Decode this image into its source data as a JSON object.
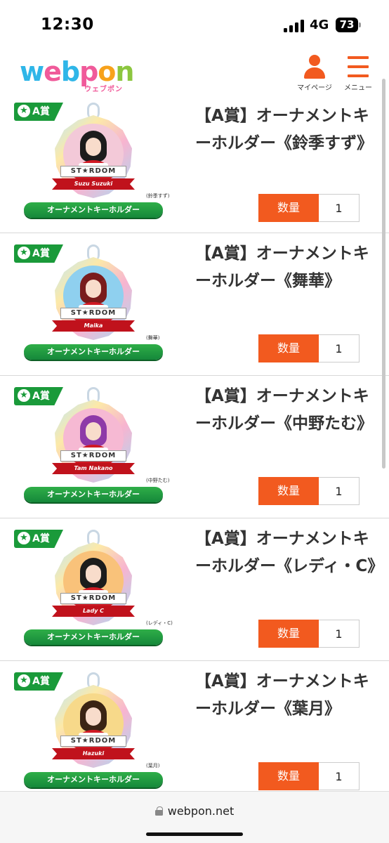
{
  "status_bar": {
    "time": "12:30",
    "network": "4G",
    "battery": "73"
  },
  "header": {
    "logo": {
      "w": "w",
      "e": "e",
      "b": "b",
      "p": "p",
      "o": "o",
      "n": "n",
      "sub": "ウェブポン"
    },
    "mypage_label": "マイページ",
    "menu_label": "メニュー"
  },
  "products": [
    {
      "badge": "A賞",
      "title": "【A賞】オーナメントキーホルダー《鈴季すず》",
      "stardom": "ST★RDOM",
      "ribbon": "Suzu Suzuki",
      "caption": "(鈴季すず)",
      "pill": "オーナメントキーホルダー",
      "qty_label": "数量",
      "qty_value": "1",
      "hair": "#1c1c1c",
      "bg": "#f3c9d8"
    },
    {
      "badge": "A賞",
      "title": "【A賞】オーナメントキーホルダー《舞華》",
      "stardom": "ST★RDOM",
      "ribbon": "Maika",
      "caption": "(舞華)",
      "pill": "オーナメントキーホルダー",
      "qty_label": "数量",
      "qty_value": "1",
      "hair": "#7a1c1c",
      "bg": "#8fd0ef"
    },
    {
      "badge": "A賞",
      "title": "【A賞】オーナメントキーホルダー《中野たむ》",
      "stardom": "ST★RDOM",
      "ribbon": "Tam Nakano",
      "caption": "(中野たむ)",
      "pill": "オーナメントキーホルダー",
      "qty_label": "数量",
      "qty_value": "1",
      "hair": "#8e3aa8",
      "bg": "#f6b9d3"
    },
    {
      "badge": "A賞",
      "title": "【A賞】オーナメントキーホルダー《レディ・C》",
      "stardom": "ST★RDOM",
      "ribbon": "Lady C",
      "caption": "(レディ・C)",
      "pill": "オーナメントキーホルダー",
      "qty_label": "数量",
      "qty_value": "1",
      "hair": "#1c1c1c",
      "bg": "#f9c27a"
    },
    {
      "badge": "A賞",
      "title": "【A賞】オーナメントキーホルダー《葉月》",
      "stardom": "ST★RDOM",
      "ribbon": "Hazuki",
      "caption": "(葉月)",
      "pill": "オーナメントキーホルダー",
      "qty_label": "数量",
      "qty_value": "1",
      "hair": "#3a2414",
      "bg": "#f7d98a"
    }
  ],
  "url_bar": {
    "url": "webpon.net"
  }
}
